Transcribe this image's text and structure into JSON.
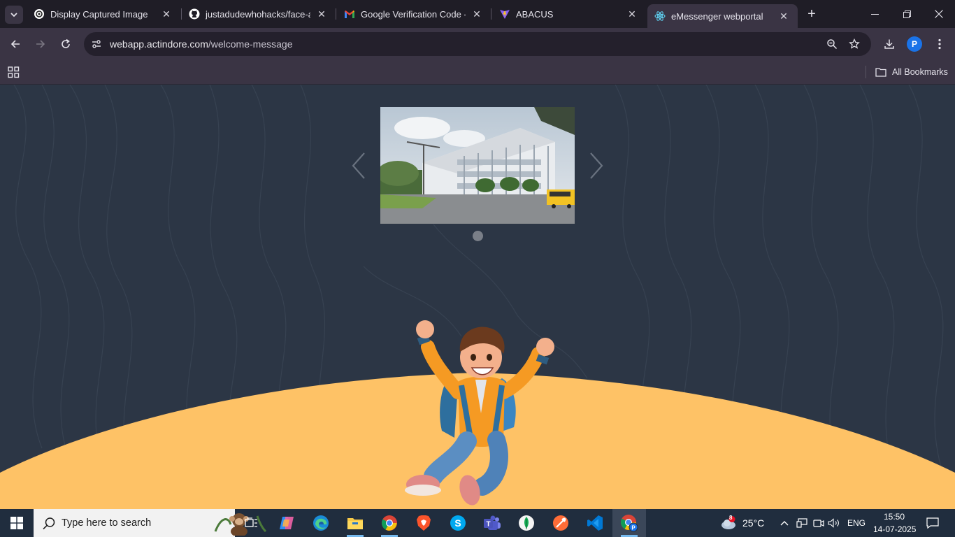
{
  "browser": {
    "tabs": [
      {
        "title": "Display Captured Image",
        "icon": "openai-icon"
      },
      {
        "title": "justadudewhohacks/face-api",
        "icon": "github-icon"
      },
      {
        "title": "Google Verification Code - p",
        "icon": "gmail-icon"
      },
      {
        "title": "ABACUS",
        "icon": "vite-icon"
      },
      {
        "title": "eMessenger webportal",
        "icon": "react-icon",
        "active": true
      }
    ],
    "address": {
      "host": "webapp.actindore.com",
      "path": "/welcome-message"
    },
    "profile_initial": "P",
    "bookmarks_label": "All Bookmarks"
  },
  "page": {
    "carousel": {
      "slide_count": 1,
      "current_slide": 1,
      "image": "college-building-photo"
    },
    "colors": {
      "background": "#2c3645",
      "hill": "#fec266"
    }
  },
  "taskbar": {
    "search_placeholder": "Type here to search",
    "apps": [
      "task-view",
      "copilot",
      "edge",
      "file-explorer",
      "chrome",
      "brave",
      "skype",
      "teams",
      "mongodb-compass",
      "postman",
      "vscode",
      "chrome-profile"
    ],
    "weather": {
      "badge": "8",
      "temp": "25°C"
    },
    "language": "ENG",
    "time": "15:50",
    "date": "14-07-2025"
  }
}
